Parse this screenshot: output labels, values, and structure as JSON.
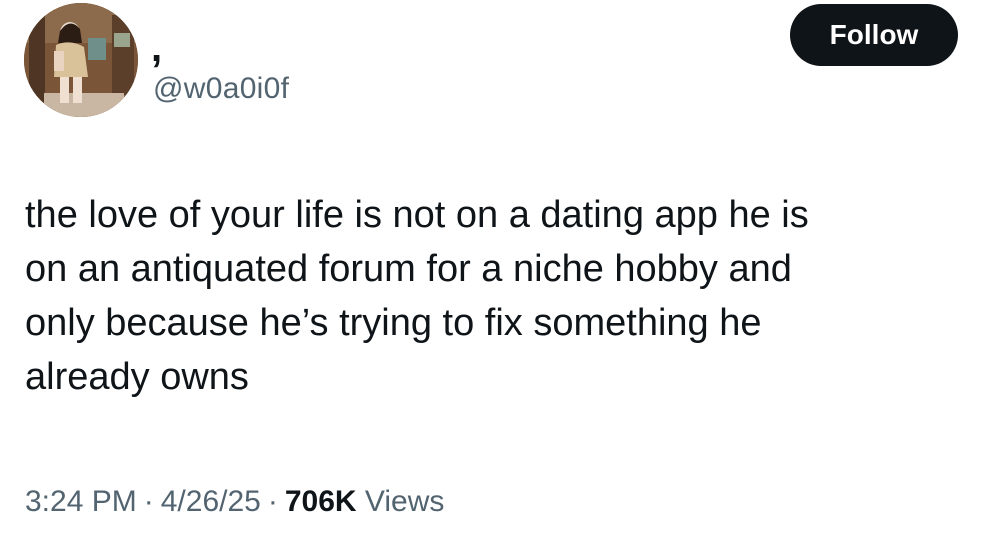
{
  "author": {
    "display_name": ",",
    "handle": "@w0a0i0f"
  },
  "actions": {
    "follow_label": "Follow"
  },
  "tweet": {
    "lines": [
      "the love of your life is not on a dating app he is",
      "on an antiquated forum for a niche hobby and",
      "only because he’s trying to fix something he",
      "already owns"
    ],
    "time": "3:24 PM",
    "date": "4/26/25",
    "separator": "·",
    "views_count": "706K",
    "views_label": "Views"
  },
  "colors": {
    "text_primary": "#0f1419",
    "text_secondary": "#536471",
    "button_bg": "#0f1419",
    "button_text": "#ffffff"
  }
}
